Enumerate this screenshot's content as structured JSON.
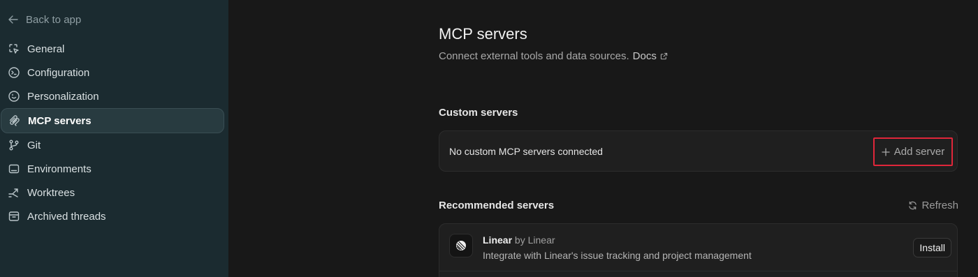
{
  "sidebar": {
    "back_label": "Back to app",
    "items": [
      {
        "label": "General",
        "icon": "cursor-select-icon"
      },
      {
        "label": "Configuration",
        "icon": "terminal-circle-icon"
      },
      {
        "label": "Personalization",
        "icon": "smiley-circle-icon"
      },
      {
        "label": "MCP servers",
        "icon": "mcp-icon",
        "active": true
      },
      {
        "label": "Git",
        "icon": "git-branch-icon"
      },
      {
        "label": "Environments",
        "icon": "monitor-icon"
      },
      {
        "label": "Worktrees",
        "icon": "worktree-icon"
      },
      {
        "label": "Archived threads",
        "icon": "archive-box-icon"
      }
    ]
  },
  "main": {
    "title": "MCP servers",
    "subtitle": "Connect external tools and data sources.",
    "docs_label": "Docs",
    "custom": {
      "section_title": "Custom servers",
      "empty_text": "No custom MCP servers connected",
      "add_label": "Add server"
    },
    "recommended": {
      "section_title": "Recommended servers",
      "refresh_label": "Refresh",
      "items": [
        {
          "name": "Linear",
          "by_prefix": "by",
          "publisher": "Linear",
          "description": "Integrate with Linear's issue tracking and project management",
          "action_label": "Install"
        }
      ]
    }
  },
  "colors": {
    "sidebar_bg": "#1b2b30",
    "main_bg": "#181818",
    "highlight_border": "#e0263a"
  }
}
